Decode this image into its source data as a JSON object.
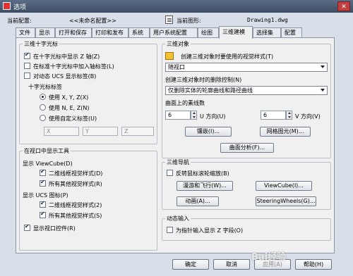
{
  "window": {
    "title": "选项"
  },
  "header": {
    "current_profile_label": "当前配置:",
    "current_profile_value": "<<未命名配置>>",
    "current_drawing_label": "当前图形:",
    "current_drawing_value": "Drawing1.dwg"
  },
  "tabs": [
    {
      "label": "文件"
    },
    {
      "label": "显示"
    },
    {
      "label": "打开和保存"
    },
    {
      "label": "打印和发布"
    },
    {
      "label": "系统"
    },
    {
      "label": "用户系统配置"
    },
    {
      "label": "绘图"
    },
    {
      "label": "三维建模"
    },
    {
      "label": "选择集"
    },
    {
      "label": "配置"
    }
  ],
  "crosshair": {
    "title": "三维十字光标",
    "show_z_axis": "在十字光标中显示 Z 轴(Z)",
    "label_axes": "在标准十字光标中加入轴标签(L)",
    "ucs_icon_label": "对动态 UCS 显示标签(B)",
    "labels_title": "十字光标标签",
    "opt_xyz": "使用 X, Y, Z(X)",
    "opt_nez": "使用 N, E, Z(N)",
    "opt_custom": "使用自定义标签(U)",
    "custom_x": "X",
    "custom_y": "Y",
    "custom_z": "Z"
  },
  "viewport_tools": {
    "title": "在视口中显示工具",
    "viewcube_title": "显示 ViewCube(D)",
    "vc_2d": "二维线框视觉样式(D)",
    "vc_all": "所有其他视觉样式(R)",
    "ucs_title": "显示 UCS 图标(P)",
    "ucs_2d": "二维线框视觉样式(2)",
    "ucs_all": "所有其他视觉样式(S)",
    "viewport_controls": "显示视口控件(R)"
  },
  "objects3d": {
    "title": "三维对象",
    "visual_style_label": "创建三维对象时要使用的视觉样式(T)",
    "visual_style_value": "随视口",
    "deletion_label": "创建三维对象时的删除控制(N)",
    "deletion_value": "仅删除实体的轮廓曲线和路径曲线",
    "isolines_title": "曲面上的素线数",
    "u_value": "6",
    "u_label": "U 方向(U)",
    "v_value": "6",
    "v_label": "V 方向(V)",
    "mosaic_button": "镶嵌(I)...",
    "mesh_button": "网格图元(M)...",
    "surface_button": "曲面分析(F)..."
  },
  "navigation": {
    "title": "三维导航",
    "reverse_zoom": "反转鼠标滚轮缩放(B)",
    "walkfly_button": "漫游和飞行(W)...",
    "viewcube_button": "ViewCube(I)...",
    "animation_button": "动画(A)...",
    "steering_button": "SteeringWheels(G)..."
  },
  "dynamic_input": {
    "title": "动态输入",
    "z_field": "为指针输入显示 Z 字段(O)"
  },
  "footer": {
    "ok": "确定",
    "cancel": "取消",
    "apply": "应用(A)",
    "help": "帮助(H)"
  },
  "watermark": "Bai经验"
}
